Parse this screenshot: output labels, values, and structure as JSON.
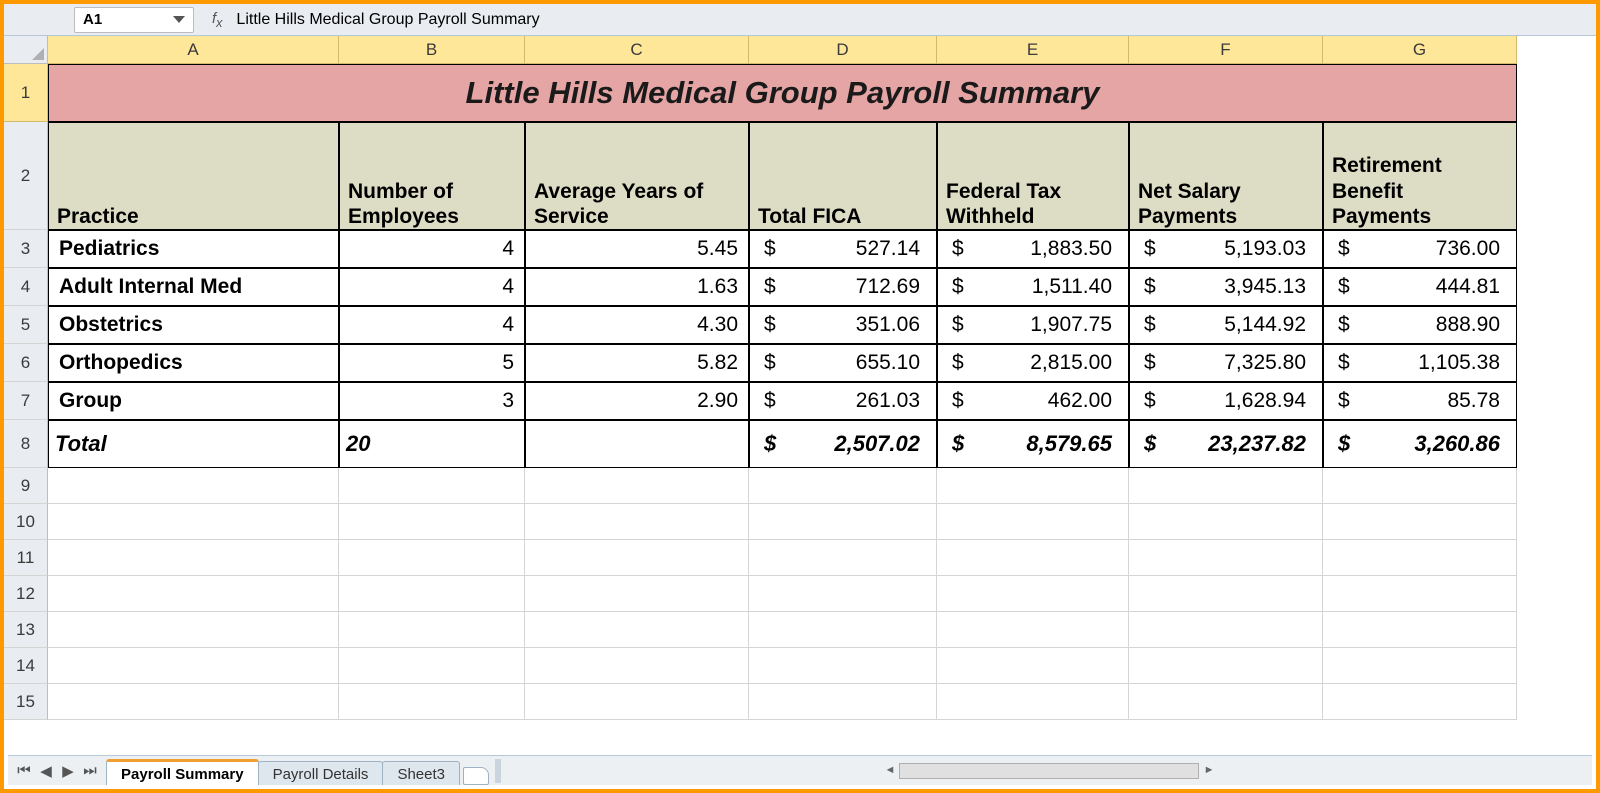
{
  "nameBox": "A1",
  "formulaBar": "Little Hills Medical Group Payroll Summary",
  "columns": [
    "A",
    "B",
    "C",
    "D",
    "E",
    "F",
    "G"
  ],
  "title": "Little Hills Medical Group Payroll Summary",
  "headers": {
    "practice": "Practice",
    "numEmp": "Number of Employees",
    "avgYears": "Average Years of Service",
    "totalFICA": "Total FICA",
    "fedTax": "Federal Tax Withheld",
    "netSalary": "Net Salary Payments",
    "retirement": "Retirement Benefit Payments"
  },
  "rows": [
    {
      "n": "3",
      "practice": "Pediatrics",
      "emp": "4",
      "years": "5.45",
      "fica": "527.14",
      "fed": "1,883.50",
      "net": "5,193.03",
      "ret": "736.00"
    },
    {
      "n": "4",
      "practice": "Adult Internal Med",
      "emp": "4",
      "years": "1.63",
      "fica": "712.69",
      "fed": "1,511.40",
      "net": "3,945.13",
      "ret": "444.81"
    },
    {
      "n": "5",
      "practice": "Obstetrics",
      "emp": "4",
      "years": "4.30",
      "fica": "351.06",
      "fed": "1,907.75",
      "net": "5,144.92",
      "ret": "888.90"
    },
    {
      "n": "6",
      "practice": "Orthopedics",
      "emp": "5",
      "years": "5.82",
      "fica": "655.10",
      "fed": "2,815.00",
      "net": "7,325.80",
      "ret": "1,105.38"
    },
    {
      "n": "7",
      "practice": "Group",
      "emp": "3",
      "years": "2.90",
      "fica": "261.03",
      "fed": "462.00",
      "net": "1,628.94",
      "ret": "85.78"
    }
  ],
  "totalRow": {
    "n": "8",
    "label": "Total",
    "emp": "20",
    "fica": "2,507.02",
    "fed": "8,579.65",
    "net": "23,237.82",
    "ret": "3,260.86"
  },
  "emptyRowNums": [
    "9",
    "10",
    "11",
    "12",
    "13",
    "14",
    "15"
  ],
  "sheetTabs": {
    "t1": "Payroll Summary",
    "t2": "Payroll Details",
    "t3": "Sheet3"
  },
  "dollar": "$"
}
